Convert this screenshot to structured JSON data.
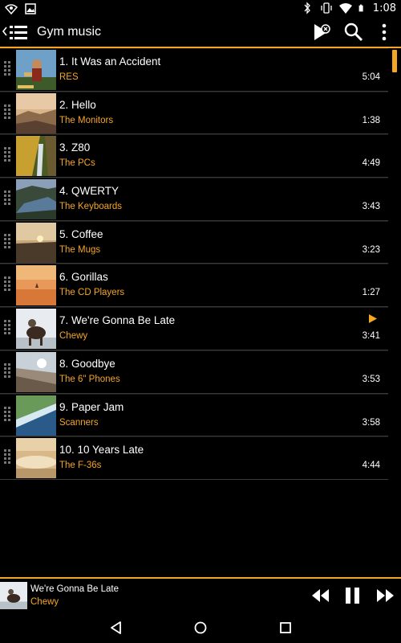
{
  "status_bar": {
    "time": "1:08",
    "icons": [
      "wifi-settings-icon",
      "image-icon",
      "bluetooth-icon",
      "vibrate-icon",
      "wifi-signal-icon",
      "battery-icon"
    ]
  },
  "action_bar": {
    "title": "Gym music",
    "icons": [
      "back-icon",
      "menu-icon",
      "play-queue-icon",
      "search-icon",
      "overflow-menu-icon"
    ]
  },
  "colors": {
    "accent": "#f5a623",
    "background": "#000000",
    "divider": "#3a3a3a"
  },
  "tracks": [
    {
      "title": "1. It Was an Accident",
      "artist": "RES",
      "duration": "5:04",
      "playing": false
    },
    {
      "title": "2. Hello",
      "artist": "The Monitors",
      "duration": "1:38",
      "playing": false
    },
    {
      "title": "3. Z80",
      "artist": "The PCs",
      "duration": "4:49",
      "playing": false
    },
    {
      "title": "4. QWERTY",
      "artist": "The Keyboards",
      "duration": "3:43",
      "playing": false
    },
    {
      "title": "5. Coffee",
      "artist": "The Mugs",
      "duration": "3:23",
      "playing": false
    },
    {
      "title": "6. Gorillas",
      "artist": "The CD Players",
      "duration": "1:27",
      "playing": false
    },
    {
      "title": "7. We're Gonna Be Late",
      "artist": "Chewy",
      "duration": "3:41",
      "playing": true
    },
    {
      "title": "8. Goodbye",
      "artist": "The 6\" Phones",
      "duration": "3:53",
      "playing": false
    },
    {
      "title": "9. Paper Jam",
      "artist": "Scanners",
      "duration": "3:58",
      "playing": false
    },
    {
      "title": "10. 10 Years Late",
      "artist": "The F-36s",
      "duration": "4:44",
      "playing": false
    }
  ],
  "now_playing": {
    "title": "We're Gonna Be Late",
    "artist": "Chewy",
    "controls": [
      "rewind-icon",
      "pause-icon",
      "fast-forward-icon"
    ]
  },
  "navigation": [
    "back-nav-icon",
    "home-nav-icon",
    "recents-nav-icon"
  ]
}
